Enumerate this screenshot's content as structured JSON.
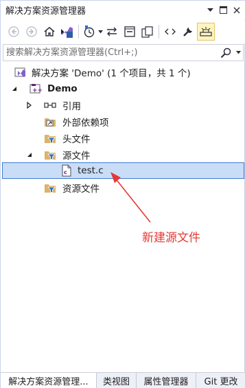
{
  "window": {
    "title": "解决方案资源管理器"
  },
  "search": {
    "placeholder": "搜索解决方案资源管理器(Ctrl+;)"
  },
  "tree": {
    "solution": "解决方案 'Demo' (1 个项目，共 1 个)",
    "project": "Demo",
    "references": "引用",
    "external_deps": "外部依赖项",
    "header_files": "头文件",
    "source_files": "源文件",
    "source_file_test": "test.c",
    "resource_files": "资源文件"
  },
  "annotation": {
    "text": "新建源文件",
    "color": "#e53935"
  },
  "tabs": [
    {
      "label": "解决方案资源管理...",
      "active": true
    },
    {
      "label": "类视图",
      "active": false
    },
    {
      "label": "属性管理器",
      "active": false
    },
    {
      "label": "Git 更改",
      "active": false
    }
  ],
  "colors": {
    "selection_bg": "#c9ddf7",
    "selection_border": "#3f7ad1",
    "folder": "#dcb367",
    "vs_purple": "#68217a"
  }
}
